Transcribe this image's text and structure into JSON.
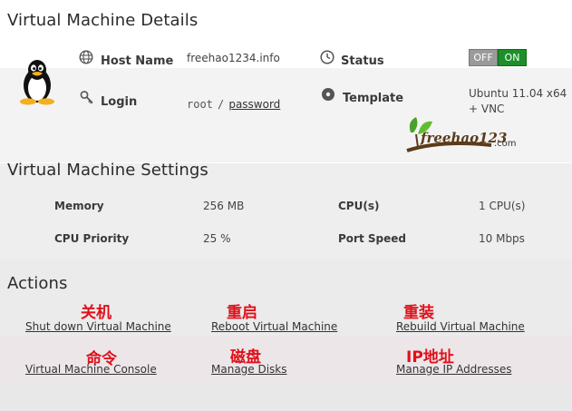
{
  "vm_details": {
    "title": "Virtual Machine Details",
    "host_name_label": "Host Name",
    "host_name_value": "freehao1234.info",
    "status_label": "Status",
    "status_off": "OFF",
    "status_on": "ON",
    "login_label": "Login",
    "login_user": "root",
    "login_sep": "/",
    "login_password_link": "password",
    "template_label": "Template",
    "template_value_line1": "Ubuntu 11.04 x64",
    "template_value_line2": "+ VNC",
    "logo_text": "freehao123",
    "logo_tld": ".com"
  },
  "settings": {
    "title": "Virtual Machine Settings",
    "memory_label": "Memory",
    "memory_value": "256 MB",
    "cpu_label": "CPU(s)",
    "cpu_value": "1 CPU(s)",
    "priority_label": "CPU Priority",
    "priority_value": "25 %",
    "port_label": "Port Speed",
    "port_value": "10 Mbps"
  },
  "actions": {
    "title": "Actions",
    "items": [
      {
        "annotation": "关机",
        "label": "Shut down Virtual Machine"
      },
      {
        "annotation": "重启",
        "label": "Reboot Virtual Machine"
      },
      {
        "annotation": "重装",
        "label": "Rebuild Virtual Machine"
      },
      {
        "annotation": "命令",
        "label": "Virtual Machine Console"
      },
      {
        "annotation": "磁盘",
        "label": "Manage Disks"
      },
      {
        "annotation": "IP地址",
        "label": "Manage IP Addresses"
      }
    ]
  },
  "colors": {
    "status_on": "#1d8f2a",
    "status_off": "#9a9a9a",
    "annotation": "#e0101a"
  },
  "icons": {
    "os": "tux-penguin-icon",
    "host": "globe-icon",
    "status": "clock-icon",
    "login": "key-icon",
    "template": "disc-icon"
  }
}
